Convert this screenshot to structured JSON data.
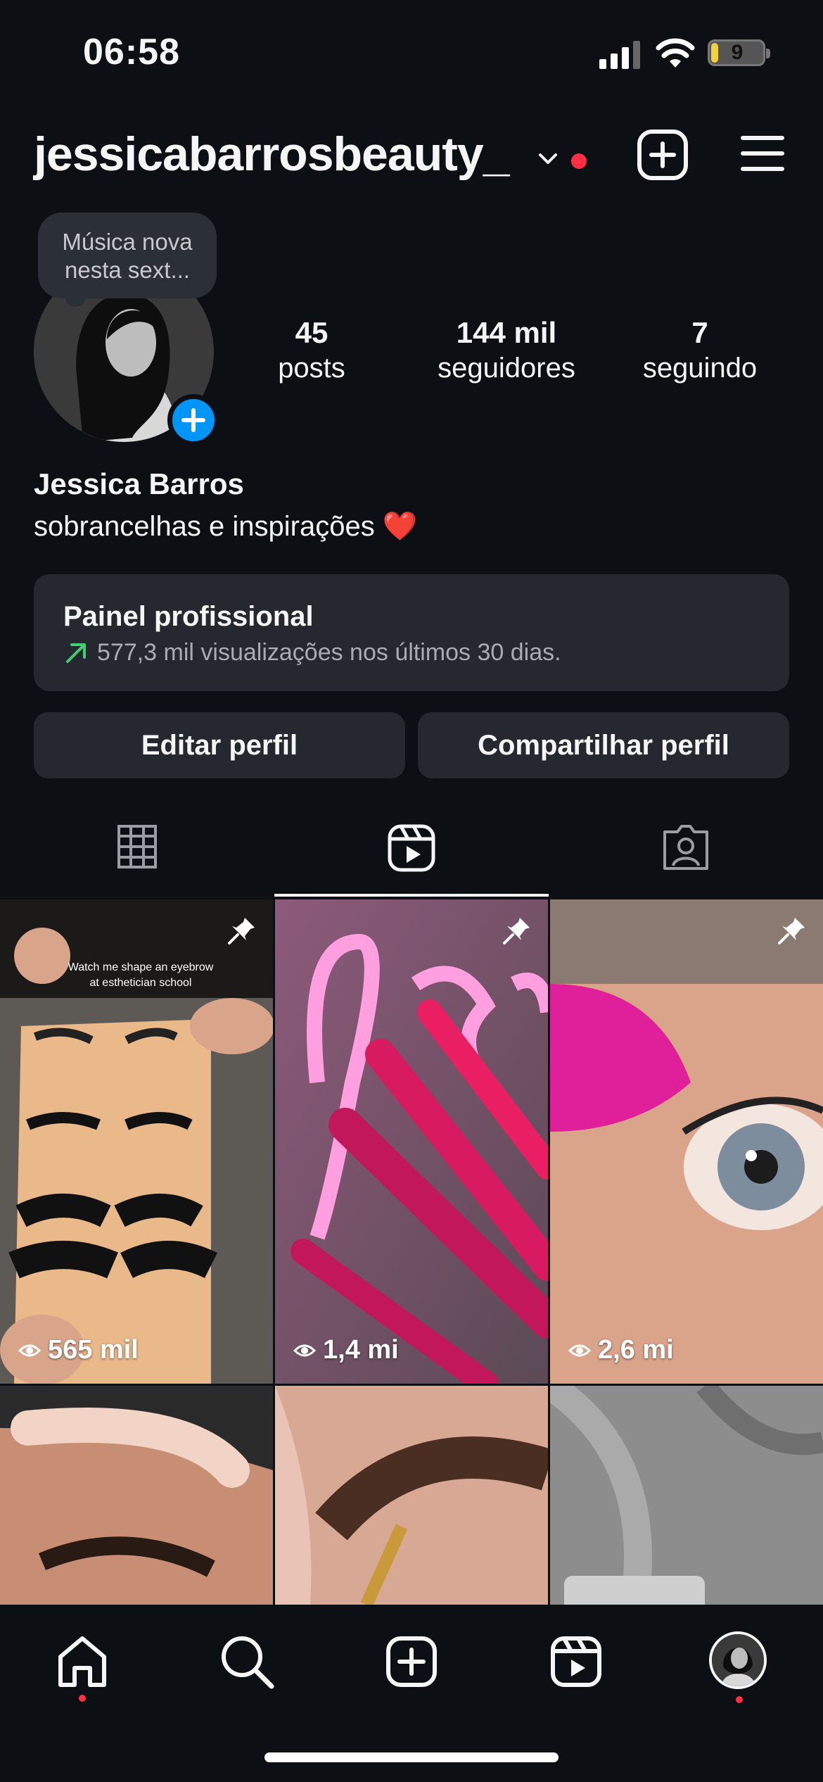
{
  "status_bar": {
    "time": "06:58",
    "battery": "9"
  },
  "header": {
    "username": "jessicabarrosbeauty_"
  },
  "profile": {
    "note_bubble": "Música nova nesta sext...",
    "stats": [
      {
        "value": "45",
        "label": "posts"
      },
      {
        "value": "144 mil",
        "label": "seguidores"
      },
      {
        "value": "7",
        "label": "seguindo"
      }
    ],
    "full_name": "Jessica Barros",
    "bio": "sobrancelhas e inspirações ❤️"
  },
  "pro_panel": {
    "title": "Painel profissional",
    "subtitle": "577,3 mil visualizações nos últimos 30 dias."
  },
  "actions": {
    "edit": "Editar perfil",
    "share": "Compartilhar perfil"
  },
  "tabs": [
    {
      "name": "grid-icon",
      "active": false
    },
    {
      "name": "reels-icon",
      "active": true
    },
    {
      "name": "tagged-icon",
      "active": false
    }
  ],
  "reels": [
    {
      "views": "565 mil",
      "pinned": true,
      "caption": "Watch me shape an eyebrow at esthetician school"
    },
    {
      "views": "1,4 mi",
      "pinned": true
    },
    {
      "views": "2,6 mi",
      "pinned": true
    },
    {
      "views": "",
      "pinned": false
    },
    {
      "views": "",
      "pinned": false
    },
    {
      "views": "",
      "pinned": false
    }
  ],
  "nav": [
    "home-icon",
    "search-icon",
    "create-icon",
    "reels-icon",
    "profile-avatar"
  ],
  "colors": {
    "background": "#0c0f14",
    "accent": "#0095f6",
    "notification": "#ff2e44",
    "panel": "#25282e"
  }
}
